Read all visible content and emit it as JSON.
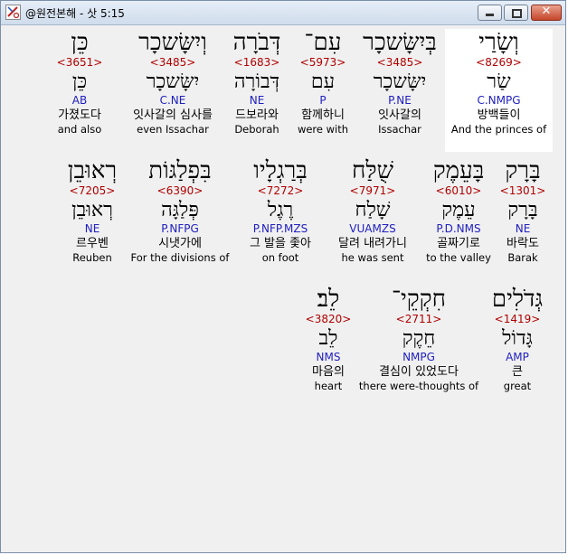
{
  "window": {
    "title": "@원전본해 - 삿 5:15"
  },
  "colors": {
    "strong": "#b00000",
    "morph": "#2020c0",
    "background": "#f0f0f0",
    "selected": "#ffffff"
  },
  "rows": [
    [
      {
        "heb": "וְשָׂרַי",
        "strong": "<8269>",
        "lex": "שַׂר",
        "morph": "C.NMPG",
        "kor": "방백들이",
        "eng": "And the princes of"
      },
      {
        "heb": "בְּיִשָּׂשכָר",
        "strong": "<3485>",
        "lex": "יִשָּׂשכָר",
        "morph": "P.NE",
        "kor": "잇사갈의",
        "eng": "Issachar"
      },
      {
        "heb": "עִם־",
        "strong": "<5973>",
        "lex": "עִם",
        "morph": "P",
        "kor": "함께하니",
        "eng": "were with"
      },
      {
        "heb": "דְּבֹרָה",
        "strong": "<1683>",
        "lex": "דְּבוֹרָה",
        "morph": "NE",
        "kor": "드보라와",
        "eng": "Deborah"
      },
      {
        "heb": "וְיִשָּׂשכָר",
        "strong": "<3485>",
        "lex": "יִשָּׂשכָר",
        "morph": "C.NE",
        "kor": "잇사갈의 심사를",
        "eng": "even Issachar"
      },
      {
        "heb": "כֵּן",
        "strong": "<3651>",
        "lex": "כֵּן",
        "morph": "AB",
        "kor": "가졌도다",
        "eng": "and also"
      }
    ],
    [
      {
        "heb": "בָּרָק",
        "strong": "<1301>",
        "lex": "בָּרָק",
        "morph": "NE",
        "kor": "바락도",
        "eng": "Barak"
      },
      {
        "heb": "בָּעֵמֶק",
        "strong": "<6010>",
        "lex": "עֵמֶק",
        "morph": "P.D.NMS",
        "kor": "골짜기로",
        "eng": "to the valley"
      },
      {
        "heb": "שֻׁלַּח",
        "strong": "<7971>",
        "lex": "שָׁלַח",
        "morph": "VUAMZS",
        "kor": "달려 내려가니",
        "eng": "he was sent"
      },
      {
        "heb": "בְּרַגְלָיו",
        "strong": "<7272>",
        "lex": "רֶגֶל",
        "morph": "P.NFP.MZS",
        "kor": "그 발을 좇아",
        "eng": "on foot"
      },
      {
        "heb": "בִּפְלַגּוֹת",
        "strong": "<6390>",
        "lex": "פְּלַגָּה",
        "morph": "P.NFPG",
        "kor": "시냇가에",
        "eng": "For the divisions of"
      },
      {
        "heb": "רְאוּבֵן",
        "strong": "<7205>",
        "lex": "רְאוּבֵן",
        "morph": "NE",
        "kor": "르우벤",
        "eng": "Reuben"
      }
    ],
    [
      {
        "heb": "גְּדֹלִים",
        "strong": "<1419>",
        "lex": "גָּדוֹל",
        "morph": "AMP",
        "kor": "큰",
        "eng": "great"
      },
      {
        "heb": "חִקְקֵי־",
        "strong": "<2711>",
        "lex": "חֵקֶק",
        "morph": "NMPG",
        "kor": "결심이 있었도다",
        "eng": "there were-thoughts of"
      },
      {
        "heb": "לֵב׃",
        "strong": "<3820>",
        "lex": "לֵב",
        "morph": "NMS",
        "kor": "마음의",
        "eng": "heart"
      }
    ]
  ]
}
